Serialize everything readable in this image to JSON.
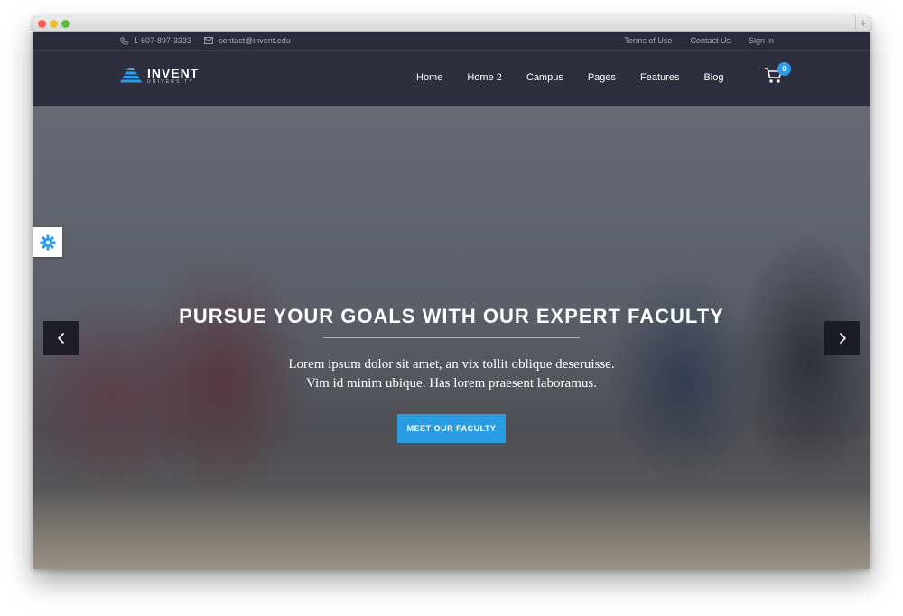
{
  "topbar": {
    "phone": "1-607-897-3333",
    "email": "contact@invent.edu",
    "links": [
      "Terms of Use",
      "Contact Us",
      "Sign In"
    ]
  },
  "logo": {
    "name": "INVENT",
    "sub": "UNIVERSITY"
  },
  "nav": {
    "items": [
      "Home",
      "Home 2",
      "Campus",
      "Pages",
      "Features",
      "Blog"
    ]
  },
  "cart": {
    "count": "0"
  },
  "hero": {
    "title": "PURSUE YOUR GOALS WITH OUR EXPERT FACULTY",
    "lead_line1": "Lorem ipsum dolor sit amet, an vix tollit oblique deseruisse.",
    "lead_line2": "Vim id minim ubique. Has lorem praesent laboramus.",
    "cta": "MEET OUR FACULTY"
  },
  "colors": {
    "accent": "#2a9ce2",
    "header": "#2d2e3e"
  },
  "icons": [
    "phone-icon",
    "mail-icon",
    "cart-icon",
    "gear-icon",
    "chevron-left-icon",
    "chevron-right-icon"
  ]
}
